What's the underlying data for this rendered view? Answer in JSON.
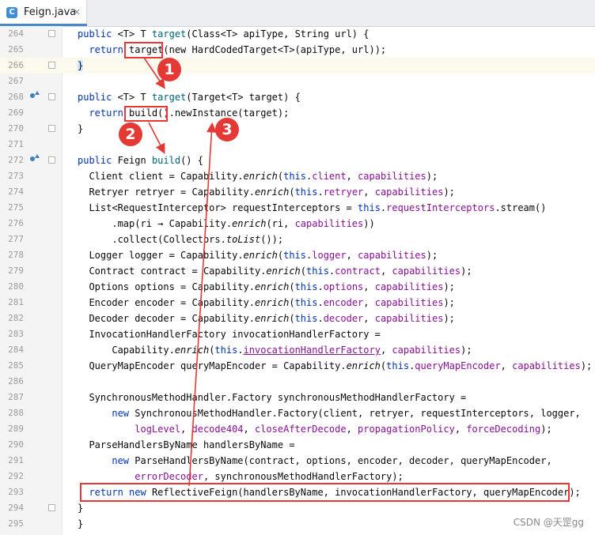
{
  "tab": {
    "icon_letter": "C",
    "filename": "Feign.java",
    "close": "×"
  },
  "lines": [
    {
      "n": "264",
      "tokens": [
        [
          "kw",
          "public "
        ],
        [
          "",
          "<T> T "
        ],
        [
          "m",
          "target"
        ],
        [
          "",
          "(Class<T> apiType, String url) {"
        ]
      ]
    },
    {
      "n": "265",
      "tokens": [
        [
          "",
          "  "
        ],
        [
          "kw",
          "return "
        ],
        [
          "",
          "target(new HardCodedTarget<T>(apiType, url));"
        ]
      ]
    },
    {
      "n": "266",
      "tokens": [
        [
          "bracket",
          "}"
        ]
      ]
    },
    {
      "n": "267",
      "tokens": []
    },
    {
      "n": "268",
      "tokens": [
        [
          "kw",
          "public "
        ],
        [
          "",
          "<T> T "
        ],
        [
          "m",
          "target"
        ],
        [
          "",
          "(Target<T> target) {"
        ]
      ]
    },
    {
      "n": "269",
      "tokens": [
        [
          "",
          "  "
        ],
        [
          "kw",
          "return "
        ],
        [
          "",
          "build().newInstance(target);"
        ]
      ]
    },
    {
      "n": "270",
      "tokens": [
        [
          "",
          "}"
        ]
      ]
    },
    {
      "n": "271",
      "tokens": []
    },
    {
      "n": "272",
      "tokens": [
        [
          "kw",
          "public "
        ],
        [
          "",
          "Feign "
        ],
        [
          "m",
          "build"
        ],
        [
          "",
          "() {"
        ]
      ]
    },
    {
      "n": "273",
      "tokens": [
        [
          "",
          "  Client client = Capability."
        ],
        [
          "i",
          "enrich"
        ],
        [
          "",
          "("
        ],
        [
          "kw",
          "this"
        ],
        [
          "",
          "."
        ],
        [
          "f",
          "client"
        ],
        [
          "",
          ", "
        ],
        [
          "f",
          "capabilities"
        ],
        [
          "",
          ");"
        ]
      ]
    },
    {
      "n": "274",
      "tokens": [
        [
          "",
          "  Retryer retryer = Capability."
        ],
        [
          "i",
          "enrich"
        ],
        [
          "",
          "("
        ],
        [
          "kw",
          "this"
        ],
        [
          "",
          "."
        ],
        [
          "f",
          "retryer"
        ],
        [
          "",
          ", "
        ],
        [
          "f",
          "capabilities"
        ],
        [
          "",
          ");"
        ]
      ]
    },
    {
      "n": "275",
      "tokens": [
        [
          "",
          "  List<RequestInterceptor> requestInterceptors = "
        ],
        [
          "kw",
          "this"
        ],
        [
          "",
          "."
        ],
        [
          "f",
          "requestInterceptors"
        ],
        [
          "",
          ".stream()"
        ]
      ]
    },
    {
      "n": "276",
      "tokens": [
        [
          "",
          "      .map(ri → Capability."
        ],
        [
          "i",
          "enrich"
        ],
        [
          "",
          "(ri, "
        ],
        [
          "f",
          "capabilities"
        ],
        [
          "",
          "))"
        ]
      ]
    },
    {
      "n": "277",
      "tokens": [
        [
          "",
          "      .collect(Collectors."
        ],
        [
          "i",
          "toList"
        ],
        [
          "",
          "());"
        ]
      ]
    },
    {
      "n": "278",
      "tokens": [
        [
          "",
          "  Logger logger = Capability."
        ],
        [
          "i",
          "enrich"
        ],
        [
          "",
          "("
        ],
        [
          "kw",
          "this"
        ],
        [
          "",
          "."
        ],
        [
          "f",
          "logger"
        ],
        [
          "",
          ", "
        ],
        [
          "f",
          "capabilities"
        ],
        [
          "",
          ");"
        ]
      ]
    },
    {
      "n": "279",
      "tokens": [
        [
          "",
          "  Contract contract = Capability."
        ],
        [
          "i",
          "enrich"
        ],
        [
          "",
          "("
        ],
        [
          "kw",
          "this"
        ],
        [
          "",
          "."
        ],
        [
          "f",
          "contract"
        ],
        [
          "",
          ", "
        ],
        [
          "f",
          "capabilities"
        ],
        [
          "",
          ");"
        ]
      ]
    },
    {
      "n": "280",
      "tokens": [
        [
          "",
          "  Options options = Capability."
        ],
        [
          "i",
          "enrich"
        ],
        [
          "",
          "("
        ],
        [
          "kw",
          "this"
        ],
        [
          "",
          "."
        ],
        [
          "f",
          "options"
        ],
        [
          "",
          ", "
        ],
        [
          "f",
          "capabilities"
        ],
        [
          "",
          ");"
        ]
      ]
    },
    {
      "n": "281",
      "tokens": [
        [
          "",
          "  Encoder encoder = Capability."
        ],
        [
          "i",
          "enrich"
        ],
        [
          "",
          "("
        ],
        [
          "kw",
          "this"
        ],
        [
          "",
          "."
        ],
        [
          "f",
          "encoder"
        ],
        [
          "",
          ", "
        ],
        [
          "f",
          "capabilities"
        ],
        [
          "",
          ");"
        ]
      ]
    },
    {
      "n": "282",
      "tokens": [
        [
          "",
          "  Decoder decoder = Capability."
        ],
        [
          "i",
          "enrich"
        ],
        [
          "",
          "("
        ],
        [
          "kw",
          "this"
        ],
        [
          "",
          "."
        ],
        [
          "f",
          "decoder"
        ],
        [
          "",
          ", "
        ],
        [
          "f",
          "capabilities"
        ],
        [
          "",
          ");"
        ]
      ]
    },
    {
      "n": "283",
      "tokens": [
        [
          "",
          "  InvocationHandlerFactory invocationHandlerFactory ="
        ]
      ]
    },
    {
      "n": "284",
      "tokens": [
        [
          "",
          "      Capability."
        ],
        [
          "i",
          "enrich"
        ],
        [
          "",
          "("
        ],
        [
          "kw",
          "this"
        ],
        [
          "",
          "."
        ],
        [
          "fu",
          "invocationHandlerFactory"
        ],
        [
          "",
          ", "
        ],
        [
          "f",
          "capabilities"
        ],
        [
          "",
          ");"
        ]
      ]
    },
    {
      "n": "285",
      "tokens": [
        [
          "",
          "  QueryMapEncoder queryMapEncoder = Capability."
        ],
        [
          "i",
          "enrich"
        ],
        [
          "",
          "("
        ],
        [
          "kw",
          "this"
        ],
        [
          "",
          "."
        ],
        [
          "f",
          "queryMapEncoder"
        ],
        [
          "",
          ", "
        ],
        [
          "f",
          "capabilities"
        ],
        [
          "",
          ");"
        ]
      ]
    },
    {
      "n": "286",
      "tokens": []
    },
    {
      "n": "287",
      "tokens": [
        [
          "",
          "  SynchronousMethodHandler.Factory synchronousMethodHandlerFactory ="
        ]
      ]
    },
    {
      "n": "288",
      "tokens": [
        [
          "",
          "      "
        ],
        [
          "kw",
          "new "
        ],
        [
          "",
          "SynchronousMethodHandler.Factory(client, retryer, requestInterceptors, logger,"
        ]
      ]
    },
    {
      "n": "289",
      "tokens": [
        [
          "",
          "          "
        ],
        [
          "f",
          "logLevel"
        ],
        [
          "",
          ", "
        ],
        [
          "f",
          "decode404"
        ],
        [
          "",
          ", "
        ],
        [
          "f",
          "closeAfterDecode"
        ],
        [
          "",
          ", "
        ],
        [
          "f",
          "propagationPolicy"
        ],
        [
          "",
          ", "
        ],
        [
          "f",
          "forceDecoding"
        ],
        [
          "",
          ");"
        ]
      ]
    },
    {
      "n": "290",
      "tokens": [
        [
          "",
          "  ParseHandlersByName handlersByName ="
        ]
      ]
    },
    {
      "n": "291",
      "tokens": [
        [
          "",
          "      "
        ],
        [
          "kw",
          "new "
        ],
        [
          "",
          "ParseHandlersByName(contract, options, encoder, decoder, queryMapEncoder,"
        ]
      ]
    },
    {
      "n": "292",
      "tokens": [
        [
          "",
          "          "
        ],
        [
          "f",
          "errorDecoder"
        ],
        [
          "",
          ", synchronousMethodHandlerFactory);"
        ]
      ]
    },
    {
      "n": "293",
      "tokens": [
        [
          "",
          "  "
        ],
        [
          "kw",
          "return new "
        ],
        [
          "",
          "ReflectiveFeign(handlersByName, invocationHandlerFactory, queryMapEncoder);"
        ]
      ]
    },
    {
      "n": "294",
      "tokens": [
        [
          "",
          "}"
        ]
      ]
    },
    {
      "n": "295",
      "tokens": [
        [
          "",
          "}"
        ]
      ]
    }
  ],
  "markers": {
    "badge1": "1",
    "badge2": "2",
    "badge3": "3"
  },
  "watermark": "CSDN @天罡gg",
  "colors": {
    "keyword": "#0033b3",
    "method": "#00627a",
    "field": "#871094",
    "annotation_red": "#e53935"
  }
}
